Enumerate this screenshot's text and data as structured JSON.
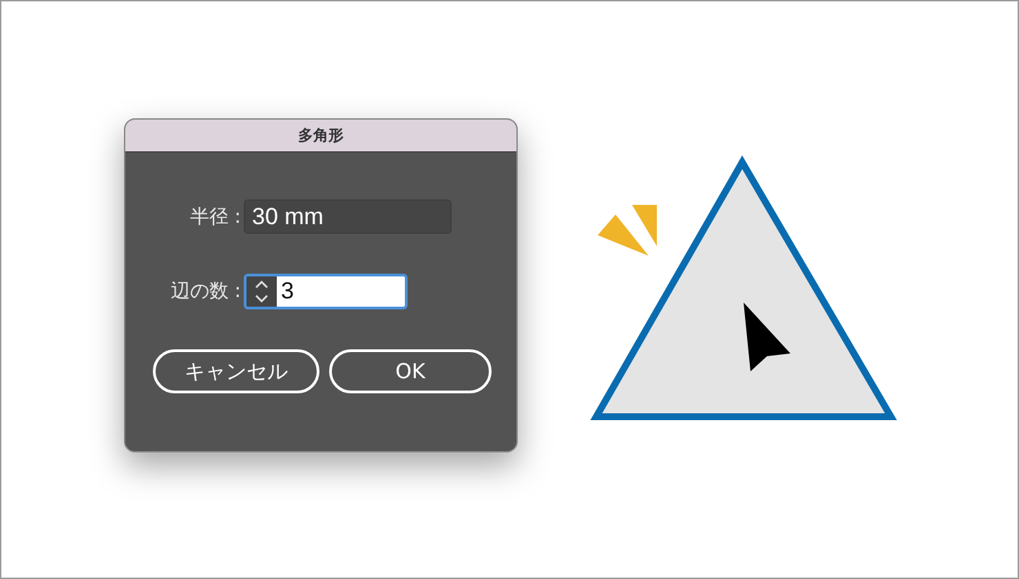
{
  "dialog": {
    "title": "多角形",
    "fields": [
      {
        "label": "半径 :",
        "value": "30 mm",
        "kind": "text",
        "focused": false
      },
      {
        "label": "辺の数 :",
        "value": "3",
        "kind": "stepper",
        "focused": true
      }
    ],
    "buttons": [
      {
        "label": "キャンセル"
      },
      {
        "label": "OK"
      }
    ]
  }
}
